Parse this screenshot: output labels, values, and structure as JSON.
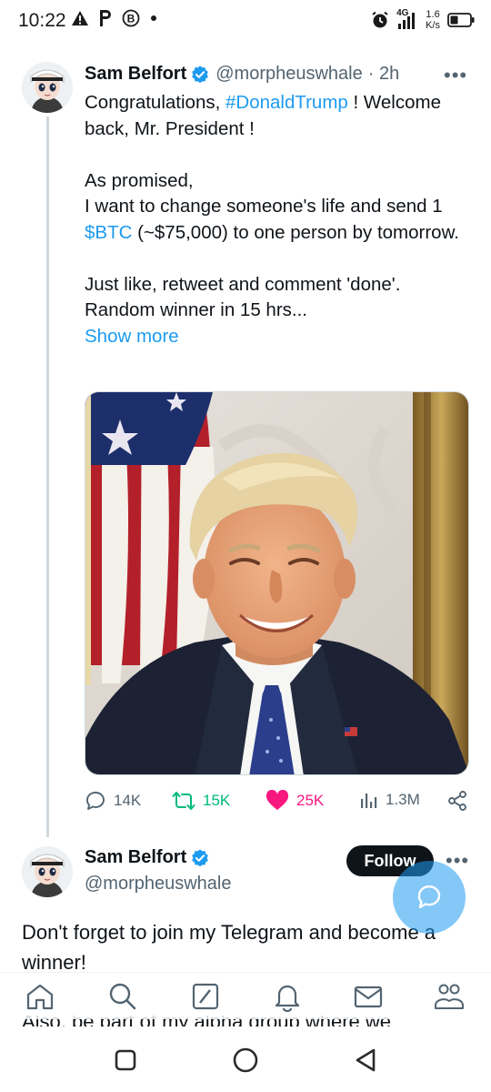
{
  "status_bar": {
    "time": "10:22",
    "network": "4G",
    "speed_value": "1.6",
    "speed_unit": "K/s",
    "left_icons": [
      "warning-icon",
      "p-icon",
      "b-circle-icon",
      "dot-icon"
    ],
    "right_icons": [
      "alarm-icon",
      "signal-icon",
      "battery-icon"
    ]
  },
  "tweet": {
    "author_name": "Sam Belfort",
    "handle": "@morpheuswhale",
    "time": "· 2h",
    "more": "•••",
    "line1_pre": "Congratulations, ",
    "hashtag": "#DonaldTrump",
    "line1_post": " ! Welcome back, Mr. President !",
    "line2": "As promised,",
    "line3": "I want to change someone's life and send 1",
    "cashtag": "$BTC",
    "line4_post": " (~$75,000) to one person by tomorrow.",
    "line5": "Just like, retweet and comment 'done'.",
    "line6": "Random winner in 15 hrs...",
    "show_more": "Show more",
    "stats": {
      "replies": "14K",
      "retweets": "15K",
      "likes": "25K",
      "views": "1.3M"
    },
    "colors": {
      "link": "#1d9bf0",
      "retweet": "#00ba7c",
      "like": "#f91880",
      "muted": "#536471"
    }
  },
  "reply": {
    "author_name": "Sam Belfort",
    "handle": "@morpheuswhale",
    "follow_label": "Follow",
    "more": "•••",
    "body": "Don't forget to join my Telegram and become a winner!",
    "peek": "Also, be part of my alpha group where we"
  },
  "bottom_nav": [
    "home-icon",
    "search-icon",
    "grok-icon",
    "notifications-icon",
    "messages-icon",
    "communities-icon"
  ],
  "system_nav": [
    "recents-button",
    "home-button",
    "back-button"
  ]
}
